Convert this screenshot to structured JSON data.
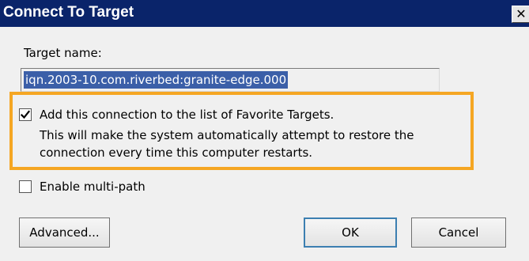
{
  "window": {
    "title": "Connect To Target",
    "close_glyph": "✕"
  },
  "target": {
    "label": "Target name:",
    "value": "iqn.2003-10.com.riverbed:granite-edge.000"
  },
  "favorites": {
    "checked": true,
    "label": "Add this connection to the list of Favorite Targets.",
    "description_line1": "This will make the system automatically attempt to restore the",
    "description_line2": "connection every time this computer restarts.",
    "highlight_color": "#f5a623"
  },
  "multipath": {
    "checked": false,
    "label": "Enable multi-path"
  },
  "buttons": {
    "advanced": "Advanced...",
    "ok": "OK",
    "cancel": "Cancel"
  },
  "icons": {
    "check": "check-icon",
    "close": "close-icon"
  },
  "colors": {
    "titlebar": "#0a246a",
    "selection": "#3b5fa8",
    "dialog_bg": "#f0f0f0"
  }
}
